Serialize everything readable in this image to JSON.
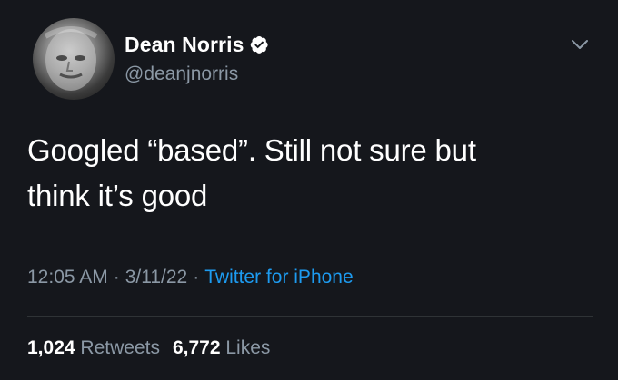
{
  "user": {
    "display_name": "Dean Norris",
    "handle": "@deanjnorris",
    "verified": true
  },
  "tweet": {
    "text_line1": "Googled “based”. Still not sure but",
    "text_line2": "think it’s good",
    "time": "12:05 AM",
    "date": "3/11/22",
    "source": "Twitter for iPhone",
    "separator": "·"
  },
  "stats": {
    "retweets_count": "1,024",
    "retweets_label": "Retweets",
    "likes_count": "6,772",
    "likes_label": "Likes"
  },
  "icons": {
    "verified": "verified-badge-icon",
    "more": "chevron-down-icon"
  },
  "colors": {
    "background": "#15171c",
    "text_primary": "#ffffff",
    "text_secondary": "#8b98a5",
    "link": "#1d9bf0",
    "divider": "#2f3336"
  }
}
